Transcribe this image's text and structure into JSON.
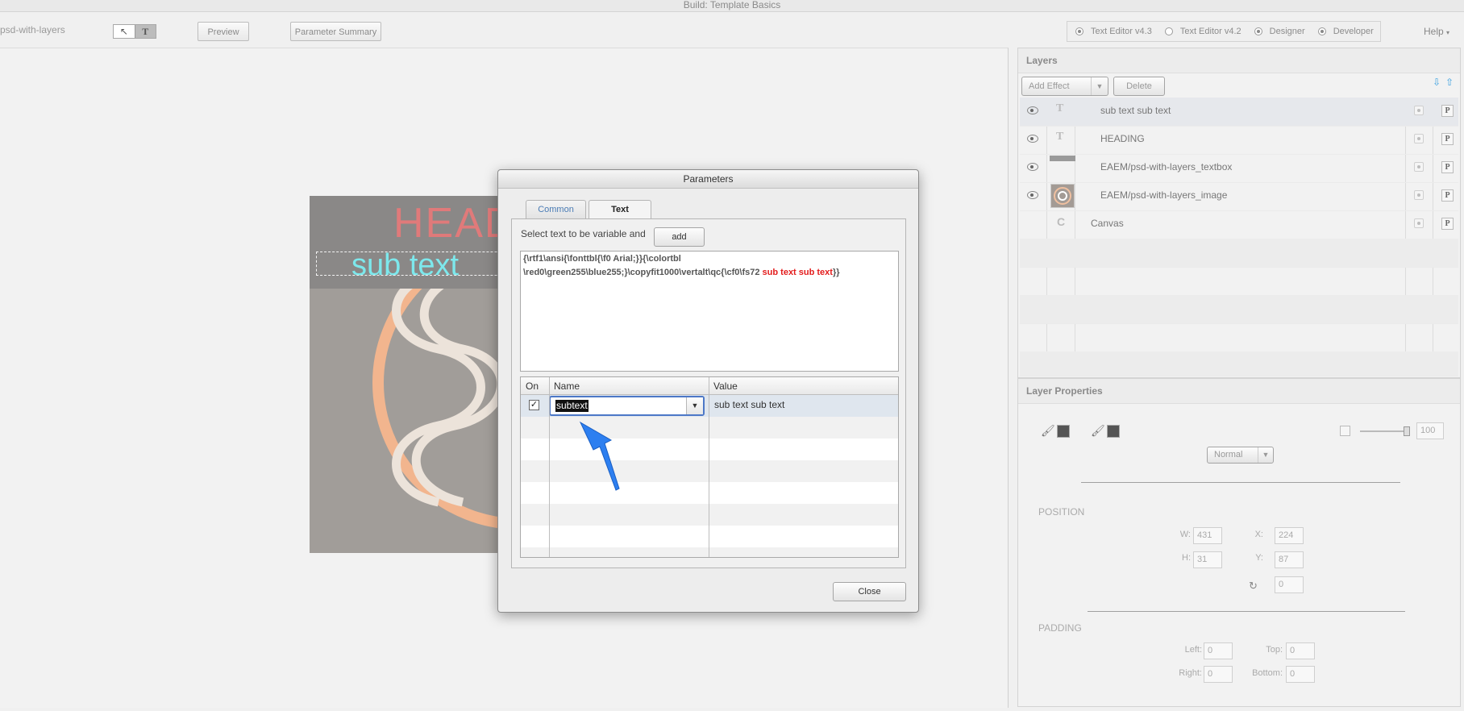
{
  "window": {
    "title": "Build: Template Basics"
  },
  "toolbar": {
    "doc_name": "psd-with-layers",
    "tool_select_icon": "arrow-cursor-icon",
    "tool_text_glyph": "T",
    "preview_label": "Preview",
    "param_summary_label": "Parameter Summary",
    "modes": [
      {
        "label": "Text Editor v4.3",
        "selected": true
      },
      {
        "label": "Text Editor v4.2",
        "selected": false
      },
      {
        "label": "Designer",
        "selected": true
      },
      {
        "label": "Developer",
        "selected": true
      }
    ],
    "help_label": "Help"
  },
  "artboard": {
    "heading_text": "HEADING",
    "subtext": "sub text"
  },
  "layers": {
    "title": "Layers",
    "add_effect_label": "Add Effect",
    "delete_label": "Delete",
    "items": [
      {
        "name": "sub text sub text",
        "type": "text",
        "visible": true
      },
      {
        "name": "HEADING",
        "type": "text",
        "visible": true
      },
      {
        "name": "EAEM/psd-with-layers_textbox",
        "type": "shape",
        "visible": true
      },
      {
        "name": "EAEM/psd-with-layers_image",
        "type": "image",
        "visible": true
      },
      {
        "name": "Canvas",
        "type": "canvas",
        "visible": false
      }
    ],
    "p_label": "P"
  },
  "layer_properties": {
    "title": "Layer Properties",
    "opacity": "100",
    "blend_mode": "Normal",
    "position_label": "POSITION",
    "w_label": "W:",
    "w": "431",
    "h_label": "H:",
    "h": "31",
    "x_label": "X:",
    "x": "224",
    "y_label": "Y:",
    "y": "87",
    "rotation": "0",
    "padding_label": "PADDING",
    "left_label": "Left:",
    "left": "0",
    "top_label": "Top:",
    "top": "0",
    "right_label": "Right:",
    "right": "0",
    "bottom_label": "Bottom:",
    "bottom": "0"
  },
  "dialog": {
    "title": "Parameters",
    "tab_common": "Common",
    "tab_text": "Text",
    "instruction": "Select text to be variable and",
    "add_label": "add",
    "rtf_line1": "{\\rtf1\\ansi{\\fonttbl{\\f0 Arial;}}{\\colortbl",
    "rtf_line2_prefix": "\\red0\\green255\\blue255;}\\copyfit1000\\vertalt\\qc{\\cf0\\fs72 ",
    "rtf_line2_highlight": "sub text sub text",
    "rtf_line2_suffix": "}}",
    "col_on": "On",
    "col_name": "Name",
    "col_value": "Value",
    "row_checked": true,
    "row_name": "subtext",
    "row_value": "sub text sub text",
    "close_label": "Close"
  },
  "colors": {
    "heading": "#e07a7a",
    "subtext": "#7de8ec",
    "rtf_highlight": "#e31c1c",
    "annotation_arrow": "#2d7ff0",
    "focus_ring": "#4d78c7"
  }
}
